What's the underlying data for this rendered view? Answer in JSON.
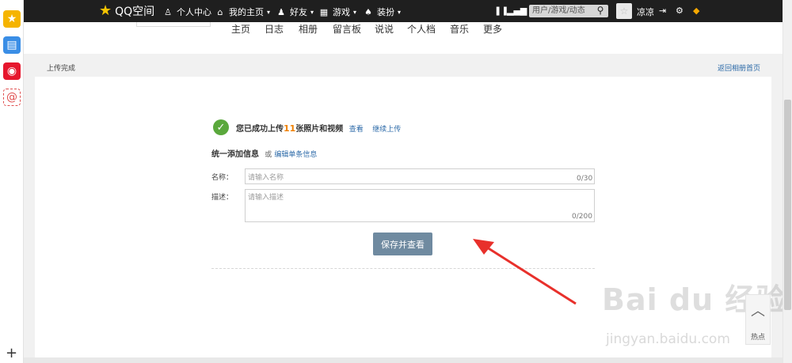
{
  "topbar": {
    "brand": "QQ空间",
    "items": [
      "个人中心",
      "我的主页",
      "好友",
      "游戏",
      "装扮"
    ],
    "search_placeholder": "用户/游戏/动态",
    "user_name": "凉凉"
  },
  "subnav": {
    "tabs": [
      "主页",
      "日志",
      "相册",
      "留言板",
      "说说",
      "个人档",
      "音乐",
      "更多"
    ]
  },
  "page": {
    "status": "上传完成",
    "back_link": "返回相册首页",
    "success_prefix": "您已成功上传",
    "success_count": "11",
    "success_suffix": "张照片和视频",
    "view_link": "查看",
    "continue_link": "继续上传",
    "unify_title": "统一添加信息",
    "or_text": "或",
    "edit_single_link": "编辑单条信息",
    "name_label": "名称：",
    "name_placeholder": "请输入名称",
    "name_counter": "0/30",
    "desc_label": "描述：",
    "desc_placeholder": "请输入描述",
    "desc_counter": "0/200",
    "save_button": "保存并查看"
  },
  "widget": {
    "hot_label": "热点"
  },
  "watermark": {
    "main": "Bai du 经验",
    "sub": "jingyan.baidu.com"
  },
  "colors": {
    "accent_link": "#2c6aa8",
    "count_orange": "#f08000",
    "arrow_red": "#e8302b",
    "success_green": "#5aa83c"
  }
}
